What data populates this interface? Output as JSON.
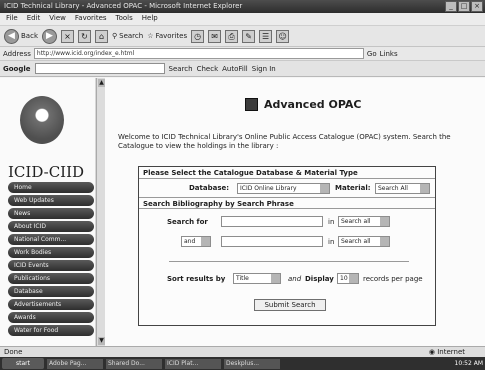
{
  "window": {
    "title": "ICID Technical Library - Advanced OPAC - Microsoft Internet Explorer"
  },
  "menu": [
    "File",
    "Edit",
    "View",
    "Favorites",
    "Tools",
    "Help"
  ],
  "toolbar": {
    "back": "Back",
    "search": "Search",
    "favorites": "Favorites"
  },
  "address": {
    "label": "Address",
    "url": "http://www.icid.org/index_e.html",
    "go": "Go",
    "links": "Links"
  },
  "google": {
    "logo": "Google",
    "search_btn": "Search",
    "check": "Check",
    "autofill": "AutoFill",
    "signin": "Sign In"
  },
  "sidebar": {
    "org": "ICID-CIID",
    "nav": [
      "Home",
      "Web Updates",
      "News",
      "About ICID",
      "National Comm...",
      "Work Bodies",
      "ICID Events",
      "Publications",
      "Database",
      "Advertisements",
      "Awards",
      "Water for Food"
    ]
  },
  "content": {
    "heading": "Advanced OPAC",
    "welcome": "Welcome to ICID Technical Library's Online Public Access Catalogue (OPAC) system. Search the Catalogue to view the holdings in the library :"
  },
  "form": {
    "section1": "Please Select the Catalogue Database & Material Type",
    "database_label": "Database:",
    "database_value": "ICID Online Library",
    "material_label": "Material:",
    "material_value": "Search All",
    "section2": "Search Bibliography by Search Phrase",
    "search_for_label": "Search for",
    "in_label": "in",
    "in_value": "Search all",
    "bool_value": "and",
    "sort_label": "Sort results by",
    "sort_value": "Title",
    "and_label": "and",
    "display_label": "Display",
    "display_value": "10",
    "per_page": "records per page",
    "submit": "Submit Search"
  },
  "status": {
    "text": "Done",
    "zone": "Internet"
  },
  "taskbar": {
    "start": "start",
    "tasks": [
      "Adobe Pag...",
      "Shared Do...",
      "ICID Plat...",
      "Deskplus..."
    ],
    "clock": "10:52 AM"
  }
}
